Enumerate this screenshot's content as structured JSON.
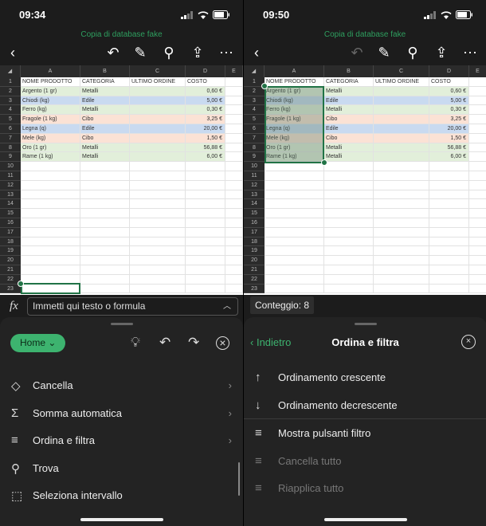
{
  "left": {
    "time": "09:34",
    "doc_title": "Copia di database fake",
    "columns": [
      "A",
      "B",
      "C",
      "D",
      "E"
    ],
    "rows": [
      "1",
      "2",
      "3",
      "4",
      "5",
      "6",
      "7",
      "8",
      "9",
      "10",
      "11",
      "12",
      "13",
      "14",
      "15",
      "16",
      "17",
      "18",
      "19",
      "20",
      "21",
      "22",
      "23"
    ],
    "formula_placeholder": "Immetti qui testo o formula",
    "home_label": "Home",
    "menu": [
      {
        "icon": "eraser-icon",
        "glyph": "◇",
        "label": "Cancella",
        "arrow": true
      },
      {
        "icon": "sigma-icon",
        "glyph": "Σ",
        "label": "Somma automatica",
        "arrow": true
      },
      {
        "icon": "filter-icon",
        "glyph": "≡",
        "label": "Ordina e filtra",
        "arrow": true
      },
      {
        "icon": "search-icon",
        "glyph": "⚲",
        "label": "Trova",
        "arrow": false
      },
      {
        "icon": "select-range-icon",
        "glyph": "⬚",
        "label": "Seleziona intervallo",
        "arrow": false
      }
    ]
  },
  "right": {
    "time": "09:50",
    "doc_title": "Copia di database fake",
    "conteggio": "Conteggio: 8",
    "back_label": "Indietro",
    "panel_title": "Ordina e filtra",
    "menu": [
      {
        "icon": "arrow-up-icon",
        "glyph": "↑",
        "label": "Ordinamento crescente",
        "enabled": true
      },
      {
        "icon": "arrow-down-icon",
        "glyph": "↓",
        "label": "Ordinamento decrescente",
        "enabled": true
      },
      {
        "icon": "filter-icon",
        "glyph": "≡",
        "label": "Mostra pulsanti filtro",
        "enabled": true
      },
      {
        "icon": "clear-filter-icon",
        "glyph": "≡",
        "label": "Cancella tutto",
        "enabled": false
      },
      {
        "icon": "reapply-filter-icon",
        "glyph": "≡",
        "label": "Riapplica tutto",
        "enabled": false
      }
    ]
  },
  "table": {
    "headers": [
      "NOME PRODOTTO",
      "CATEGORIA",
      "ULTIMO ORDINE",
      "COSTO"
    ],
    "rows": [
      {
        "name": "Argento (1 gr)",
        "cat": "Metalli",
        "cost": "0,60 €",
        "color": "green"
      },
      {
        "name": "Chiodi (kg)",
        "cat": "Edile",
        "cost": "5,00 €",
        "color": "blue"
      },
      {
        "name": "Ferro (kg)",
        "cat": "Metalli",
        "cost": "0,30 €",
        "color": "green"
      },
      {
        "name": "Fragole (1 kg)",
        "cat": "Cibo",
        "cost": "3,25 €",
        "color": "orange"
      },
      {
        "name": "Legna (q)",
        "cat": "Edile",
        "cost": "20,00 €",
        "color": "blue"
      },
      {
        "name": "Mele (kg)",
        "cat": "Cibo",
        "cost": "1,50 €",
        "color": "orange"
      },
      {
        "name": "Oro (1 gr)",
        "cat": "Metalli",
        "cost": "56,88 €",
        "color": "green"
      },
      {
        "name": "Rame (1 kg)",
        "cat": "Metalli",
        "cost": "6,00 €",
        "color": "green"
      }
    ]
  },
  "colors": {
    "accent": "#3db36f",
    "selection": "#217346"
  }
}
